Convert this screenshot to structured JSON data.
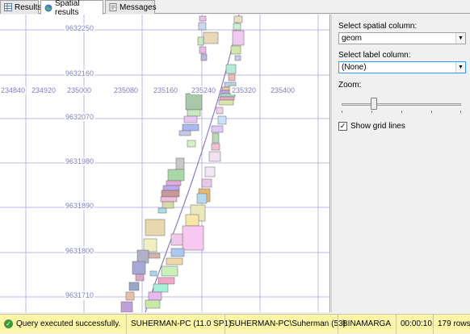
{
  "tabs": [
    {
      "label": "Results",
      "icon": "grid-icon",
      "active": false
    },
    {
      "label": "Spatial results",
      "icon": "globe-icon",
      "active": true
    },
    {
      "label": "Messages",
      "icon": "messages-icon",
      "active": false
    }
  ],
  "map": {
    "x_labels": [
      "234840",
      "234920",
      "235000",
      "235080",
      "235160",
      "235240",
      "235320",
      "235400"
    ],
    "y_labels": [
      "9632250",
      "9632160",
      "9632070",
      "9631980",
      "9631890",
      "9631800",
      "9631710"
    ],
    "grid_color": "#b8b8e8",
    "line_color": "#8a7acc"
  },
  "panel": {
    "spatial_column_label": "Select spatial column:",
    "spatial_column_value": "geom",
    "label_column_label": "Select label column:",
    "label_column_value": "(None)",
    "zoom_label": "Zoom:",
    "zoom_level": 0.27,
    "grid_lines_label": "Show grid lines",
    "grid_lines_checked": true
  },
  "status": {
    "message": "Query executed successfully.",
    "server": "SUHERMAN-PC (11.0 SP1)",
    "user": "SUHERMAN-PC\\Suherman (53)",
    "database": "BINAMARGA",
    "elapsed": "00:00:10",
    "rows": "179 rows",
    "bg_color": "#fdf6a8"
  }
}
